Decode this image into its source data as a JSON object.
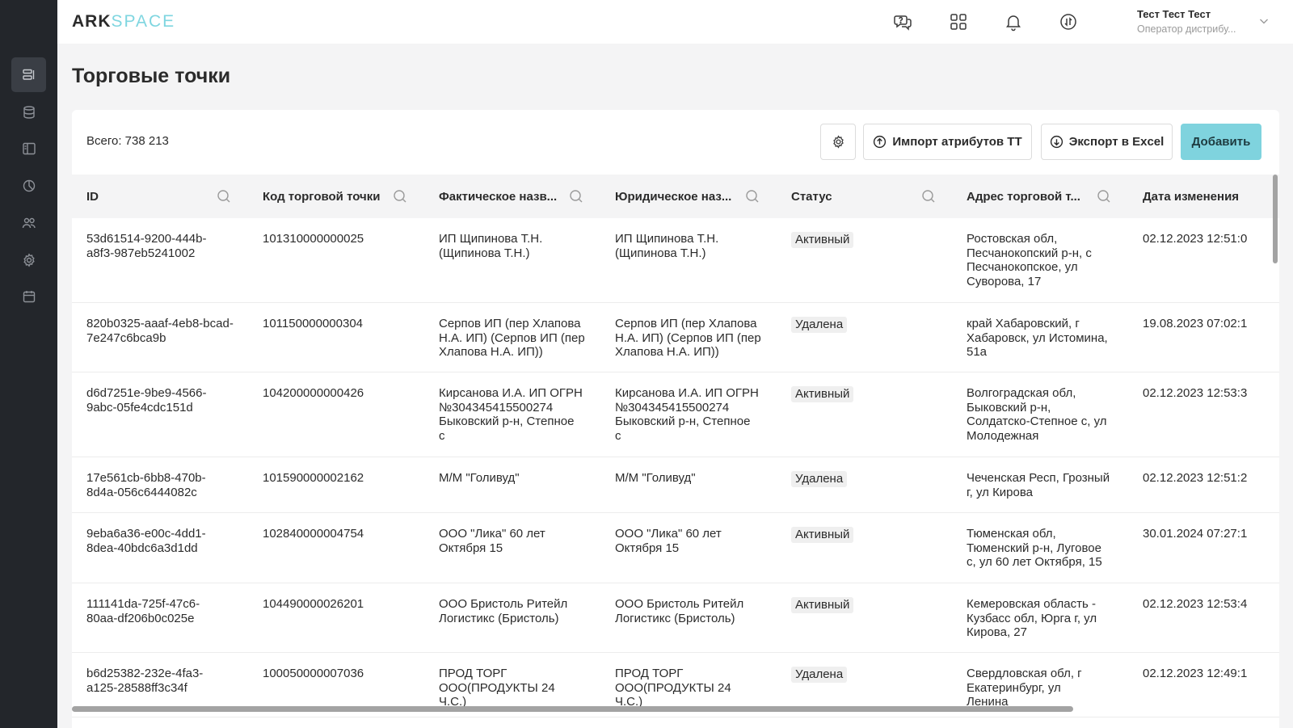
{
  "logo": {
    "part1": "ARK",
    "part2": "SPACE"
  },
  "header": {
    "user_name": "Тест Тест Тест",
    "user_role": "Оператор дистрибу..."
  },
  "sidebar": {
    "items": [
      {
        "icon": "list-icon",
        "active": true
      },
      {
        "icon": "database-icon",
        "active": false
      },
      {
        "icon": "layout-icon",
        "active": false
      },
      {
        "icon": "chart-pie-icon",
        "active": false
      },
      {
        "icon": "users-icon",
        "active": false
      },
      {
        "icon": "gear-icon",
        "active": false
      },
      {
        "icon": "calendar-icon",
        "active": false
      }
    ]
  },
  "page": {
    "title": "Торговые точки"
  },
  "toolbar": {
    "total": "Всего: 738 213",
    "import_label": "Импорт атрибутов ТТ",
    "export_label": "Экспорт в Excel",
    "add_label": "Добавить"
  },
  "table": {
    "columns": [
      "ID",
      "Код торговой точки",
      "Фактическое назв...",
      "Юридическое наз...",
      "Статус",
      "Адрес торговой т...",
      "Дата изменения"
    ],
    "rows": [
      {
        "id": [
          "53d61514-9200-444b-",
          "a8f3-987eb5241002"
        ],
        "code": "101310000000025",
        "fact": [
          "ИП Щипинова Т.Н.",
          "(Щипинова Т.Н.)"
        ],
        "legal": [
          "ИП Щипинова Т.Н.",
          "(Щипинова Т.Н.)"
        ],
        "status": "Активный",
        "address": [
          "Ростовская обл,",
          "Песчанокопский р-н, с",
          "Песчанокопское, ул",
          "Суворова, 17"
        ],
        "date": "02.12.2023 12:51:0"
      },
      {
        "id": [
          "820b0325-aaaf-4eb8-bcad-",
          "7e247c6bca9b"
        ],
        "code": "101150000000304",
        "fact": [
          "Серпов ИП (пер Хлапова",
          "Н.А. ИП) (Серпов ИП (пер",
          "Хлапова Н.А. ИП))"
        ],
        "legal": [
          "Серпов ИП (пер Хлапова",
          "Н.А. ИП) (Серпов ИП (пер",
          "Хлапова Н.А. ИП))"
        ],
        "status": "Удалена",
        "address": [
          "край Хабаровский, г",
          "Хабаровск, ул Истомина,",
          "51а"
        ],
        "date": "19.08.2023 07:02:1"
      },
      {
        "id": [
          "d6d7251e-9be9-4566-",
          "9abc-05fe4cdc151d"
        ],
        "code": "104200000000426",
        "fact": [
          "Кирсанова И.А. ИП ОГРН",
          "№304345415500274",
          "Быковский р-н, Степное",
          "с"
        ],
        "legal": [
          "Кирсанова И.А. ИП ОГРН",
          "№304345415500274",
          "Быковский р-н, Степное",
          "с"
        ],
        "status": "Активный",
        "address": [
          "Волгоградская обл,",
          "Быковский р-н,",
          "Солдатско-Степное с, ул",
          "Молодежная"
        ],
        "date": "02.12.2023 12:53:3"
      },
      {
        "id": [
          "17e561cb-6bb8-470b-",
          "8d4a-056c6444082c"
        ],
        "code": "101590000002162",
        "fact": [
          "М/М \"Голивуд\""
        ],
        "legal": [
          "М/М \"Голивуд\""
        ],
        "status": "Удалена",
        "address": [
          "Чеченская Респ, Грозный",
          "г, ул Кирова"
        ],
        "date": "02.12.2023 12:51:2"
      },
      {
        "id": [
          "9eba6a36-e00c-4dd1-",
          "8dea-40bdc6a3d1dd"
        ],
        "code": "102840000004754",
        "fact": [
          "ООО \"Лика\" 60 лет",
          "Октября 15"
        ],
        "legal": [
          "ООО \"Лика\" 60 лет",
          "Октября 15"
        ],
        "status": "Активный",
        "address": [
          "Тюменская обл,",
          "Тюменский р-н, Луговое",
          "с, ул 60 лет Октября, 15"
        ],
        "date": "30.01.2024 07:27:1"
      },
      {
        "id": [
          "111141da-725f-47c6-",
          "80aa-df206b0c025e"
        ],
        "code": "104490000026201",
        "fact": [
          "ООО Бристоль Ритейл",
          "Логистикс (Бристоль)"
        ],
        "legal": [
          "ООО Бристоль Ритейл",
          "Логистикс (Бристоль)"
        ],
        "status": "Активный",
        "address": [
          "Кемеровская область -",
          "Кузбасс обл, Юрга г, ул",
          "Кирова, 27"
        ],
        "date": "02.12.2023 12:53:4"
      },
      {
        "id": [
          "b6d25382-232e-4fa3-",
          "a125-28588ff3c34f"
        ],
        "code": "100050000007036",
        "fact": [
          "ПРОД ТОРГ",
          "ООО(ПРОДУКТЫ 24",
          "Ч.С.)"
        ],
        "legal": [
          "ПРОД ТОРГ",
          "ООО(ПРОДУКТЫ 24",
          "Ч.С.)"
        ],
        "status": "Удалена",
        "address": [
          "Свердловская обл, г",
          "Екатеринбург, ул",
          "Ленина"
        ],
        "date": "02.12.2023 12:49:1"
      }
    ]
  }
}
